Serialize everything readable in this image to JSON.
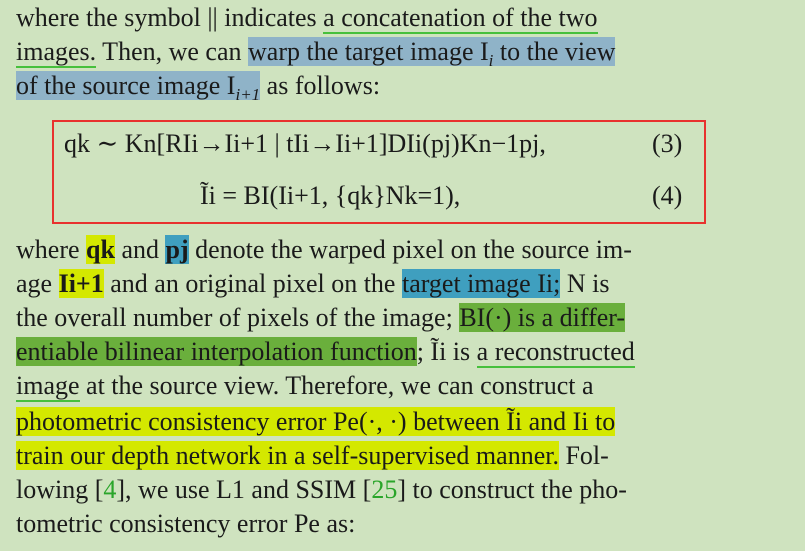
{
  "lines": {
    "l1a": "where the symbol || indicates ",
    "l1b": "a concatenation of the two",
    "l2a": "images.",
    "l2b": " Then, we can ",
    "l2c": "warp the target image I",
    "l2c_sub": "i",
    "l2d": " to the view",
    "l3a": "of the source image I",
    "l3a_sub": "i+1",
    "l3b": " as follows:",
    "eq3": "qk ∼ Kn[RIi→Ii+1 | tIi→Ii+1]DIi(pj)Kn−1pj,",
    "eq3_num": "(3)",
    "eq4": "Ĩi = BI(Ii+1, {qk}Nk=1),",
    "eq4_num": "(4)",
    "l4a": "where ",
    "l4b": "qk",
    "l4c": " and ",
    "l4d": "pj",
    "l4e": " denote the warped pixel on the source im-",
    "l5a": "age ",
    "l5b": "Ii+1",
    "l5c": " and an original pixel on the ",
    "l5d": "target image Ii;",
    "l5e": " N is",
    "l6a": "the overall number of pixels of the image; ",
    "l6b": "BI(·) is a differ-",
    "l7a": "entiable bilinear interpolation function",
    "l7b": "; Ĩi is ",
    "l7c": "a reconstructed",
    "l8a": "image",
    "l8b": " at the source view.  Therefore, we can construct a",
    "l9a": "photometric consistency error Pe(·, ·) between Ĩi and Ii to",
    "l10a": "train our depth network in a self-supervised manner.",
    "l10b": " Fol-",
    "l11a": "lowing [",
    "l11b": "4",
    "l11c": "], we use L1 and SSIM [",
    "l11d": "25",
    "l11e": "] to construct the pho-",
    "l12a": "tometric consistency error Pe as:"
  },
  "colors": {
    "background": "#cfe3bf",
    "box_border": "#e8322e",
    "highlight_blue": "#8fb3c8",
    "highlight_teal": "#3f9fbf",
    "highlight_yellow": "#d4e800",
    "highlight_green": "#6aaf3c",
    "underline_green": "#46c03c",
    "citation": "#2aa52a"
  }
}
